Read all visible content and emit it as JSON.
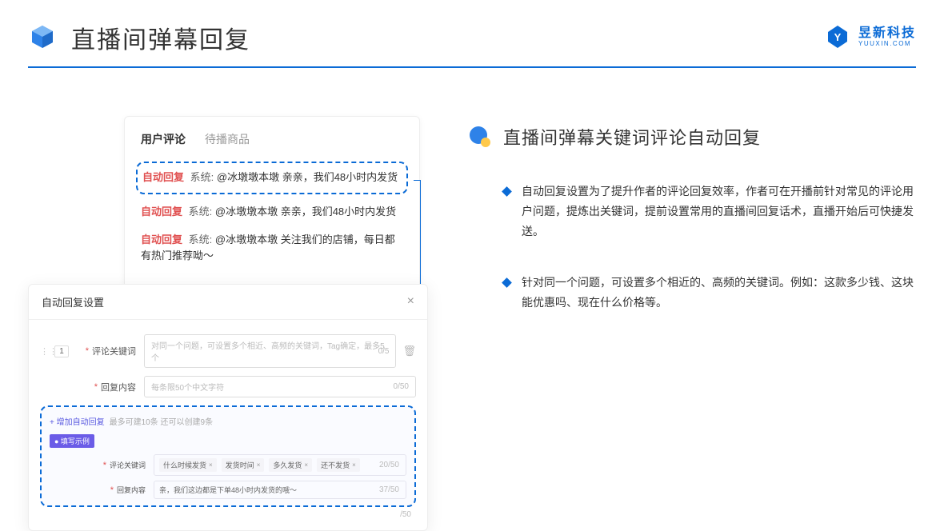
{
  "header": {
    "title": "直播间弹幕回复"
  },
  "logo": {
    "name": "昱新科技",
    "url": "YUUXIN.COM"
  },
  "commentCard": {
    "tab_active": "用户评论",
    "tab_inactive": "待播商品",
    "items": [
      {
        "tag": "自动回复",
        "sys": "系统:",
        "text": "@冰墩墩本墩 亲亲，我们48小时内发货"
      },
      {
        "tag": "自动回复",
        "sys": "系统:",
        "text": "@冰墩墩本墩 亲亲，我们48小时内发货"
      },
      {
        "tag": "自动回复",
        "sys": "系统:",
        "text": "@冰墩墩本墩 关注我们的店铺，每日都有热门推荐呦～"
      }
    ]
  },
  "dialog": {
    "title": "自动回复设置",
    "num": "1",
    "kw_label": "评论关键词",
    "kw_placeholder": "对同一个问题，可设置多个相近、高频的关键词，Tag确定，最多5个",
    "kw_counter": "0/5",
    "content_label": "回复内容",
    "content_placeholder": "每条限50个中文字符",
    "content_counter": "0/50",
    "add_link": "+ 增加自动回复",
    "add_hint": "最多可建10条 还可以创建9条",
    "example_badge": "● 填写示例",
    "ex_kw_label": "评论关键词",
    "ex_tags": [
      "什么时候发货",
      "发货时间",
      "多久发货",
      "还不发货"
    ],
    "ex_kw_counter": "20/50",
    "ex_content_label": "回复内容",
    "ex_content_text": "亲，我们这边都是下单48小时内发货的哦～",
    "ex_content_counter": "37/50",
    "outer_counter": "/50"
  },
  "right": {
    "title": "直播间弹幕关键词评论自动回复",
    "bullets": [
      "自动回复设置为了提升作者的评论回复效率，作者可在开播前针对常见的评论用户问题，提炼出关键词，提前设置常用的直播间回复话术，直播开始后可快捷发送。",
      "针对同一个问题，可设置多个相近的、高频的关键词。例如：这款多少钱、这块能优惠吗、现在什么价格等。"
    ]
  }
}
